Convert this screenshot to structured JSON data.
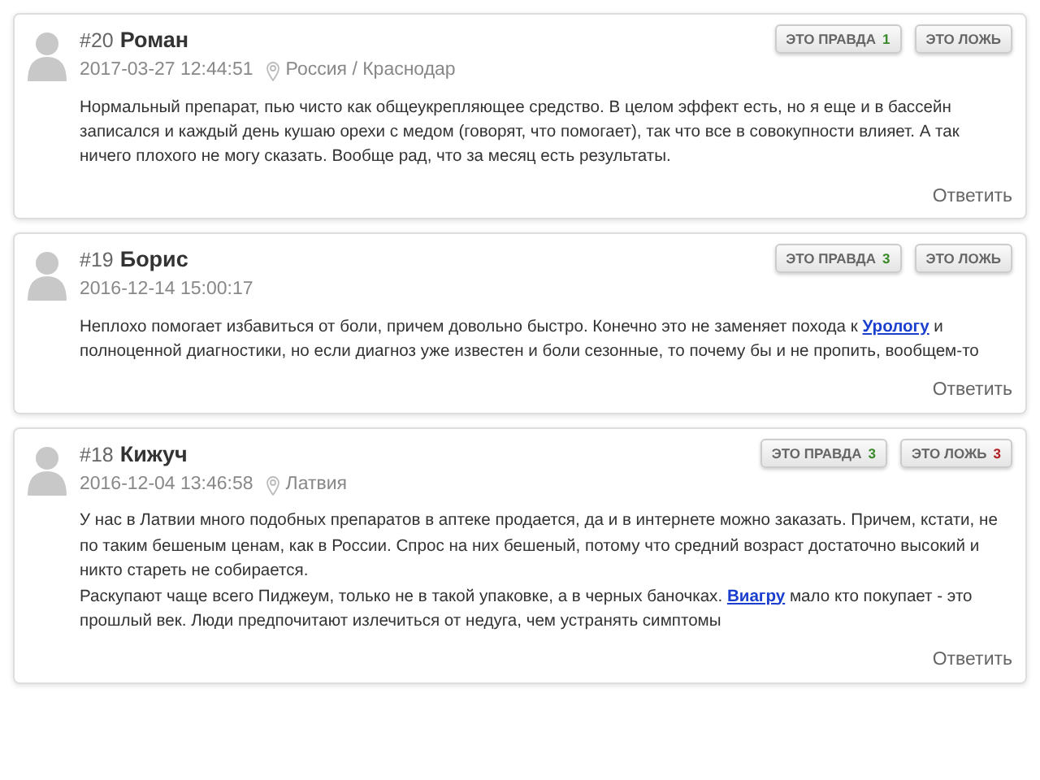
{
  "comments": [
    {
      "number": "#20",
      "author": "Роман",
      "date": "2017-03-27 12:44:51",
      "location": "Россия / Краснодар",
      "votes": [
        {
          "kind": "true",
          "label": "ЭТО ПРАВДА",
          "count": "1"
        },
        {
          "kind": "false",
          "label": "ЭТО ЛОЖЬ"
        }
      ],
      "paragraphs": [
        [
          {
            "kind": "text",
            "text": "Нормальный препарат, пью чисто как общеукрепляющее средство. В целом эффект есть, но я еще и в бассейн записался и каждый день кушаю орехи с медом (говорят, что помогает), так что все в совокупности влияет. А так ничего плохого не могу сказать. Вообще рад, что за месяц есть результаты."
          }
        ]
      ],
      "reply": "Ответить"
    },
    {
      "number": "#19",
      "author": "Борис",
      "date": "2016-12-14 15:00:17",
      "votes": [
        {
          "kind": "true",
          "label": "ЭТО ПРАВДА",
          "count": "3"
        },
        {
          "kind": "false",
          "label": "ЭТО ЛОЖЬ"
        }
      ],
      "paragraphs": [
        [
          {
            "kind": "text",
            "text": "Неплохо помогает избавиться от боли, причем довольно быстро. Конечно это не заменяет похода к "
          },
          {
            "kind": "link",
            "text": "Урологу"
          },
          {
            "kind": "text",
            "text": " и полноценной диагностики, но если диагноз уже известен и боли сезонные, то почему бы и не пропить, вообщем-то"
          }
        ]
      ],
      "reply": "Ответить"
    },
    {
      "number": "#18",
      "author": "Кижуч",
      "date": "2016-12-04 13:46:58",
      "location": "Латвия",
      "votes": [
        {
          "kind": "true",
          "label": "ЭТО ПРАВДА",
          "count": "3"
        },
        {
          "kind": "false",
          "label": "ЭТО ЛОЖЬ",
          "count": "3"
        }
      ],
      "paragraphs": [
        [
          {
            "kind": "text",
            "text": "У нас в Латвии много подобных препаратов в аптеке продается, да и в интернете можно заказать. Причем, кстати, не по таким бешеным ценам, как в России. Спрос на них бешеный, потому что средний возраст достаточно высокий и никто стареть не собирается."
          }
        ],
        [
          {
            "kind": "text",
            "text": "Раскупают чаще всего Пиджеум, только не в такой упаковке, а в черных баночках. "
          },
          {
            "kind": "link",
            "text": "Виагру"
          },
          {
            "kind": "text",
            "text": " мало кто покупает - это прошлый век. Люди предпочитают излечиться от недуга, чем устранять симптомы"
          }
        ]
      ],
      "reply": "Ответить"
    }
  ]
}
